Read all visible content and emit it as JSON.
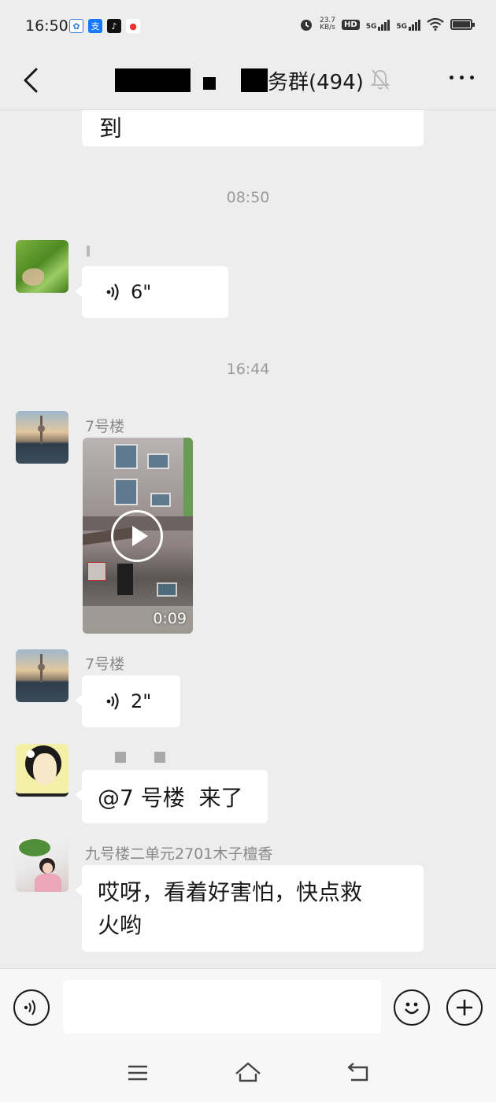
{
  "status_bar": {
    "time": "16:50",
    "net_speed_value": "23.7",
    "net_speed_unit": "KB/s",
    "hd_label": "HD",
    "sim1_label": "5G",
    "sim2_label": "5G"
  },
  "header": {
    "title_visible": "务群(494)",
    "muted": true
  },
  "messages": {
    "top_bubble_text": "到",
    "time_1": "08:50",
    "voice_1_duration": "6\"",
    "time_2": "16:44",
    "video_sender": "7号楼",
    "video_duration": "0:09",
    "voice_2_sender": "7号楼",
    "voice_2_duration": "2\"",
    "mention_text": "@7 号楼  来了",
    "last_sender": "九号楼二单元2701木子檀香",
    "last_text_line1": "哎呀，看着好害怕，快点救",
    "last_text_line2": "火哟"
  },
  "input": {
    "placeholder": ""
  },
  "colors": {
    "background": "#ededed",
    "bubble": "#ffffff",
    "meta_text": "#9a9a9a"
  }
}
